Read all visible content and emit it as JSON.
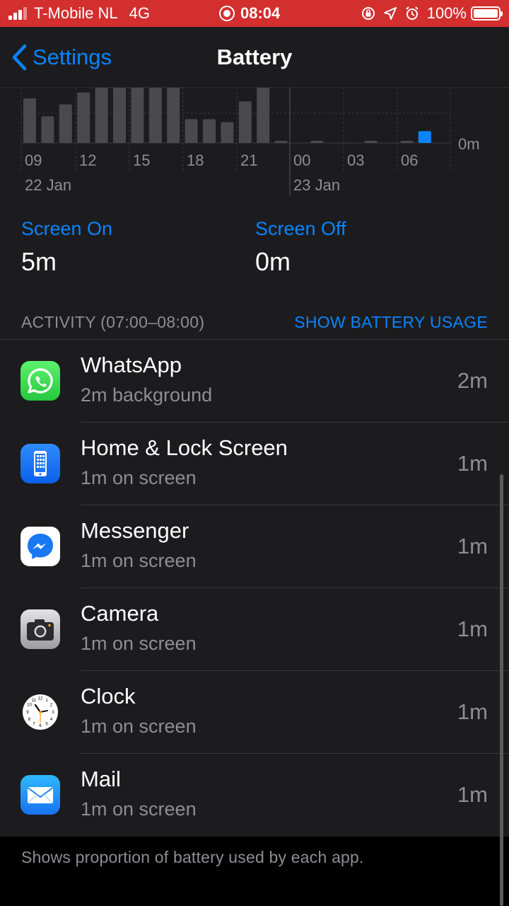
{
  "status_bar": {
    "carrier": "T-Mobile NL",
    "network": "4G",
    "time": "08:04",
    "battery_percent": "100%",
    "battery_level": 1.0,
    "background_color": "#d32f2f"
  },
  "nav": {
    "back_label": "Settings",
    "title": "Battery"
  },
  "chart_data": {
    "type": "bar",
    "x_tick_labels": [
      "09",
      "12",
      "15",
      "18",
      "21",
      "00",
      "03",
      "06"
    ],
    "date_labels": [
      "22 Jan",
      "23 Jan"
    ],
    "y_tick_labels": [
      "0m"
    ],
    "series": [
      {
        "values": [
          15,
          9,
          13,
          17,
          23,
          23,
          23,
          23,
          19,
          8,
          8,
          7,
          14,
          23,
          0.6,
          0,
          0.6,
          0,
          0,
          0.4,
          0,
          0.6,
          4
        ],
        "highlight_index": 22
      }
    ],
    "colors": {
      "bar": "#4a4a4e",
      "highlight": "#0a84ff"
    }
  },
  "screen_on": {
    "label": "Screen On",
    "value": "5m"
  },
  "screen_off": {
    "label": "Screen Off",
    "value": "0m"
  },
  "activity": {
    "title": "ACTIVITY (07:00–08:00)",
    "show_usage_label": "SHOW BATTERY USAGE",
    "apps": [
      {
        "name": "WhatsApp",
        "detail": "2m background",
        "time": "2m",
        "icon": "whatsapp-icon"
      },
      {
        "name": "Home & Lock Screen",
        "detail": "1m on screen",
        "time": "1m",
        "icon": "home-lock-screen-icon"
      },
      {
        "name": "Messenger",
        "detail": "1m on screen",
        "time": "1m",
        "icon": "messenger-icon"
      },
      {
        "name": "Camera",
        "detail": "1m on screen",
        "time": "1m",
        "icon": "camera-icon"
      },
      {
        "name": "Clock",
        "detail": "1m on screen",
        "time": "1m",
        "icon": "clock-icon"
      },
      {
        "name": "Mail",
        "detail": "1m on screen",
        "time": "1m",
        "icon": "mail-icon"
      }
    ]
  },
  "footer": {
    "text": "Shows proportion of battery used by each app."
  }
}
